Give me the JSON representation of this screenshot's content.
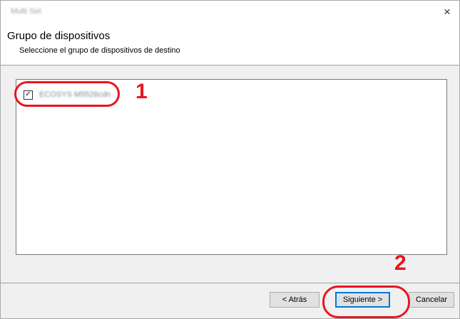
{
  "window": {
    "title": "Multi Set",
    "close_glyph": "×"
  },
  "header": {
    "title": "Grupo de dispositivos",
    "subtitle": "Seleccione el grupo de dispositivos de destino"
  },
  "device_list": {
    "items": [
      {
        "label": "ECOSYS M5526cdn",
        "checked": true,
        "check_glyph": "✓"
      }
    ]
  },
  "callouts": [
    {
      "number": "1",
      "color": "#e8161f"
    },
    {
      "number": "2",
      "color": "#e8161f"
    }
  ],
  "footer": {
    "back_label": "< Atrás",
    "next_label": "Siguiente >",
    "cancel_label": "Cancelar"
  },
  "colors": {
    "accent": "#0078d7",
    "callout": "#e8161f"
  }
}
